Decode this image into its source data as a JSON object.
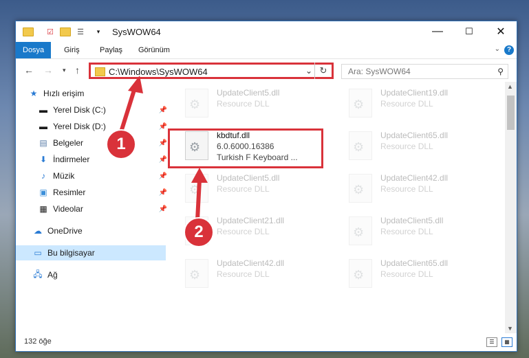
{
  "window": {
    "title": "SysWOW64",
    "minimize": "—",
    "maximize": "☐",
    "close": "✕"
  },
  "ribbon": {
    "tabs": [
      "Dosya",
      "Giriş",
      "Paylaş",
      "Görünüm"
    ],
    "help": "?"
  },
  "nav": {
    "address": "C:\\Windows\\SysWOW64",
    "search_placeholder": "Ara: SysWOW64"
  },
  "sidebar": {
    "items": [
      {
        "label": "Hızlı erişim",
        "icon": "star-icon"
      },
      {
        "label": "Yerel Disk (C:)",
        "icon": "drive-icon",
        "pinned": true
      },
      {
        "label": "Yerel Disk (D:)",
        "icon": "drive-icon",
        "pinned": true
      },
      {
        "label": "Belgeler",
        "icon": "documents-icon",
        "pinned": true
      },
      {
        "label": "İndirmeler",
        "icon": "download-icon",
        "pinned": true
      },
      {
        "label": "Müzik",
        "icon": "music-icon",
        "pinned": true
      },
      {
        "label": "Resimler",
        "icon": "pictures-icon",
        "pinned": true
      },
      {
        "label": "Videolar",
        "icon": "video-icon",
        "pinned": true
      },
      {
        "label": "OneDrive",
        "icon": "cloud-icon"
      },
      {
        "label": "Bu bilgisayar",
        "icon": "computer-icon",
        "selected": true
      },
      {
        "label": "Ağ",
        "icon": "network-icon"
      }
    ]
  },
  "files": {
    "left": [
      {
        "name": "UpdateClient5.dll",
        "type": "Resource DLL"
      },
      {
        "name": "kbdtuf.dll",
        "version": "6.0.6000.16386",
        "desc": "Turkish F Keyboard ..."
      },
      {
        "name": "UpdateClient5.dll",
        "type": "Resource DLL"
      },
      {
        "name": "UpdateClient21.dll",
        "type": "Resource DLL"
      },
      {
        "name": "UpdateClient42.dll",
        "type": "Resource DLL"
      }
    ],
    "right": [
      {
        "name": "UpdateClient19.dll",
        "type": "Resource DLL"
      },
      {
        "name": "UpdateClient65.dll",
        "type": "Resource DLL"
      },
      {
        "name": "UpdateClient42.dll",
        "type": "Resource DLL"
      },
      {
        "name": "UpdateClient5.dll",
        "type": "Resource DLL"
      },
      {
        "name": "UpdateClient65.dll",
        "type": "Resource DLL"
      }
    ]
  },
  "status": {
    "count": "132 öğe"
  },
  "annotations": {
    "badge1": "1",
    "badge2": "2"
  },
  "colors": {
    "accent": "#1979ca",
    "highlight": "#d9323a",
    "selected": "#cce8ff"
  }
}
